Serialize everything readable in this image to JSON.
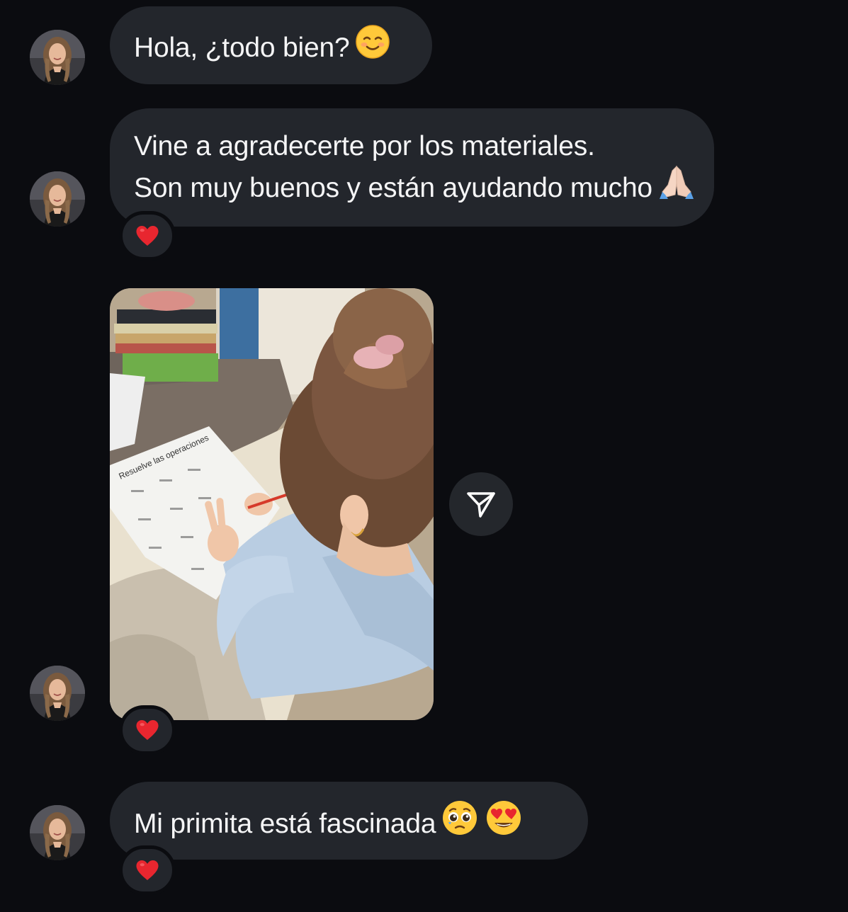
{
  "messages": [
    {
      "id": "m1",
      "text": "Hola, ¿todo bien?",
      "emoji": [
        "smiling-face-with-closed-eyes"
      ]
    },
    {
      "id": "m2",
      "lines": [
        "Vine a agradecerte por los materiales.",
        "Son muy buenos y están ayudando mucho"
      ],
      "emoji": [
        "folded-hands"
      ],
      "reaction": "heart"
    },
    {
      "id": "m3",
      "type": "photo",
      "photo_text": "Resuelve las operaciones",
      "reaction": "heart"
    },
    {
      "id": "m4",
      "text": "Mi primita está fascinada",
      "emoji": [
        "pleading-face",
        "smiling-face-with-heart-eyes"
      ],
      "reaction": "heart"
    }
  ],
  "colors": {
    "background": "#0b0c10",
    "bubble": "#23262c",
    "text": "#f5f5f6",
    "heart": "#e8262f"
  },
  "icons": {
    "share": "send-icon",
    "reaction": "heart-icon"
  }
}
